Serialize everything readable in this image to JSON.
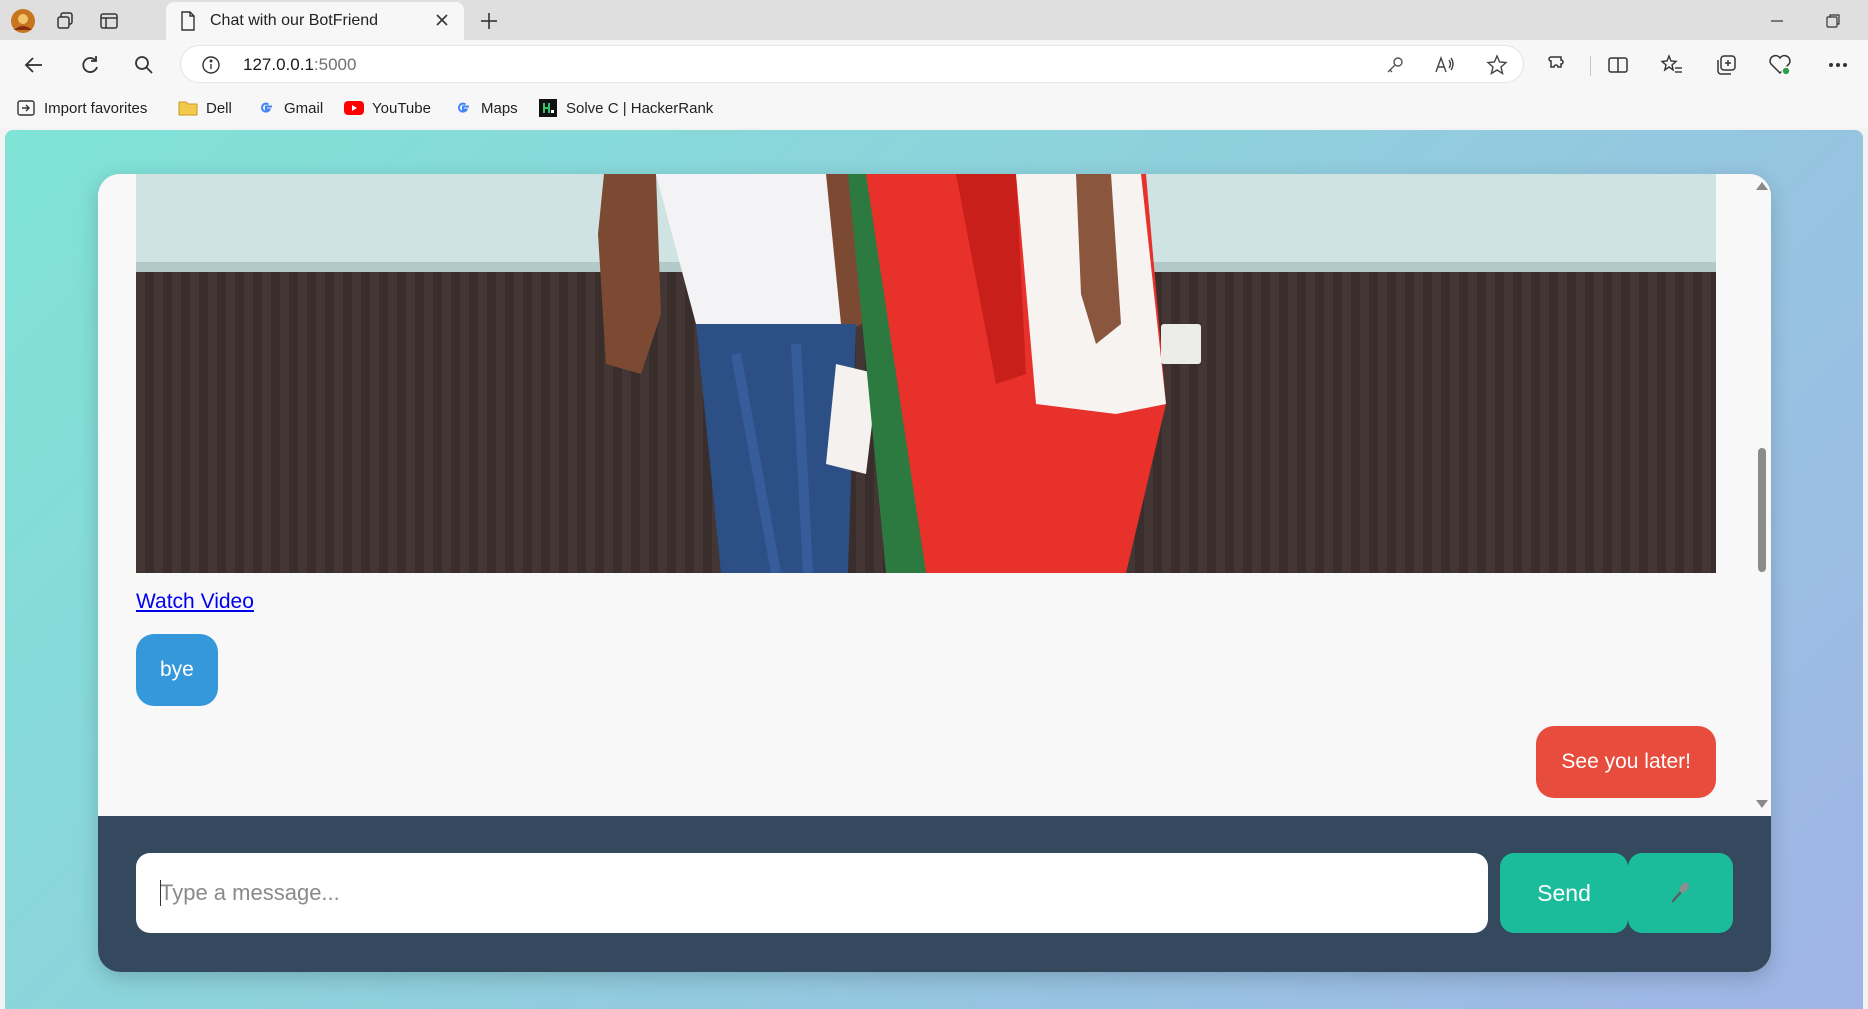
{
  "browser": {
    "tab_title": "Chat with our BotFriend",
    "url_host": "127.0.0.1",
    "url_port": ":5000"
  },
  "favorites": [
    {
      "label": "Import favorites",
      "icon": "import-icon"
    },
    {
      "label": "Dell",
      "icon": "folder-icon"
    },
    {
      "label": "Gmail",
      "icon": "google-icon"
    },
    {
      "label": "YouTube",
      "icon": "youtube-icon"
    },
    {
      "label": "Maps",
      "icon": "google-icon"
    },
    {
      "label": "Solve C | HackerRank",
      "icon": "hackerrank-icon"
    }
  ],
  "chat": {
    "watch_link_label": "Watch Video",
    "messages": [
      {
        "sender": "user",
        "text": "bye"
      },
      {
        "sender": "bot",
        "text": "See you later!"
      }
    ]
  },
  "composer": {
    "placeholder": "Type a message...",
    "value": "",
    "send_label": "Send",
    "mic_icon": "microphone-icon"
  },
  "colors": {
    "user_bubble": "#3498db",
    "bot_bubble": "#e74c3c",
    "send_button": "#1abc9c",
    "input_bar": "#34495e"
  }
}
